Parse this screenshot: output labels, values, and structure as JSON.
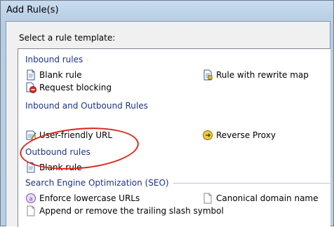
{
  "window": {
    "title": "Add Rule(s)"
  },
  "prompt": "Select a rule template:",
  "groups": [
    {
      "header": "Inbound rules"
    },
    {
      "header": "Inbound and Outbound Rules"
    },
    {
      "header": "Outbound rules"
    },
    {
      "header": "Search Engine Optimization (SEO)"
    }
  ],
  "inbound": {
    "blank_rule": "Blank rule",
    "request_blocking": "Request blocking",
    "rewrite_map": "Rule with rewrite map"
  },
  "inout": {
    "user_friendly_url": "User-friendly URL",
    "reverse_proxy": "Reverse Proxy"
  },
  "outbound": {
    "blank_rule": "Blank rule"
  },
  "seo": {
    "lowercase": "Enforce lowercase URLs",
    "canonical": "Canonical domain name",
    "trailing_slash": "Append or remove the trailing slash symbol"
  },
  "colors": {
    "group_header": "#1e3287",
    "annotation_ring": "#d9261c"
  }
}
